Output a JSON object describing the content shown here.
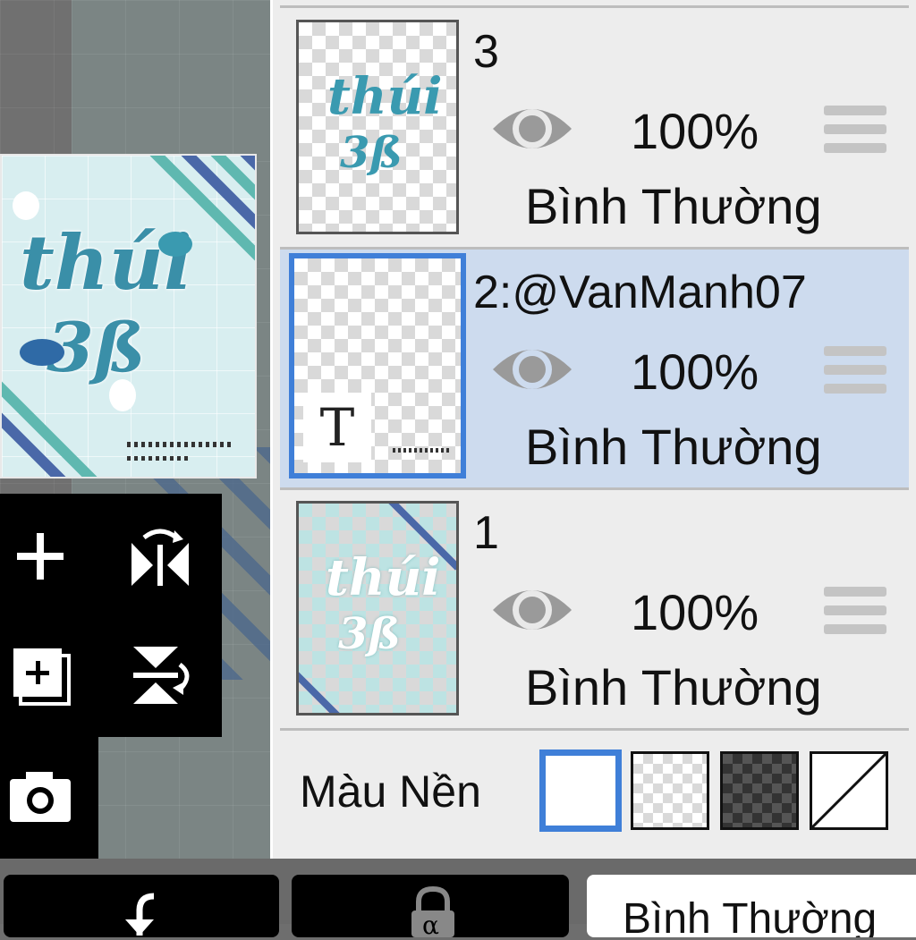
{
  "layers": [
    {
      "name": "3",
      "opacity": "100%",
      "blend": "Bình Thường",
      "selected": false
    },
    {
      "name": "2:@VanManh07",
      "opacity": "100%",
      "blend": "Bình Thường",
      "selected": true,
      "text_layer_glyph": "T"
    },
    {
      "name": "1",
      "opacity": "100%",
      "blend": "Bình Thường",
      "selected": false
    }
  ],
  "background": {
    "label": "Màu Nền",
    "options": [
      "white",
      "light-checker",
      "dark-checker",
      "none"
    ],
    "selected": "white"
  },
  "artwork": {
    "line1": "thúi",
    "line2": "3ß"
  },
  "bottom_bar": {
    "blend_mode": "Bình Thường",
    "lock_glyph": "α"
  },
  "colors": {
    "accent": "#3f7fd8",
    "selected_row": "#cddbee",
    "panel_bg": "#ededed"
  }
}
